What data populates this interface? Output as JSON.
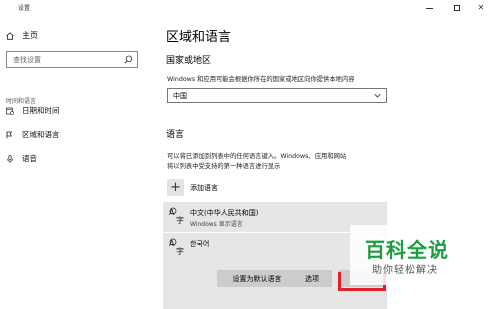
{
  "window": {
    "title": "设置"
  },
  "sidebar": {
    "home_label": "主页",
    "search_placeholder": "查找设置",
    "section_label": "时间和语言",
    "items": [
      {
        "label": "日期和时间",
        "icon": "calendar-clock-icon"
      },
      {
        "label": "区域和语言",
        "icon": "region-language-icon",
        "active": true
      },
      {
        "label": "语音",
        "icon": "microphone-icon"
      }
    ]
  },
  "main": {
    "title": "区域和语言",
    "country_heading": "国家或地区",
    "country_description": "Windows 和应用可能会根据你所在的国家或地区向你提供本地内容",
    "country_selected": "中国",
    "language_heading": "语言",
    "language_description_line1": "可以将已添加到列表中的任何语言键入。Windows、应用和网站",
    "language_description_line2": "将以列表中受支持的第一种语言进行显示",
    "add_language_label": "添加语言",
    "languages": [
      {
        "name": "中文(中华人民共和国)",
        "subtitle": "Windows 显示语言"
      },
      {
        "name": "한국어",
        "subtitle": ""
      }
    ],
    "buttons": {
      "set_default": "设置为默认语言",
      "options": "选项",
      "remove": ""
    }
  },
  "watermark": {
    "title": "百科全说",
    "subtitle": "助你轻松解决"
  },
  "colors": {
    "accent_green": "#1a9e3f",
    "highlight_red": "#e0202b"
  }
}
